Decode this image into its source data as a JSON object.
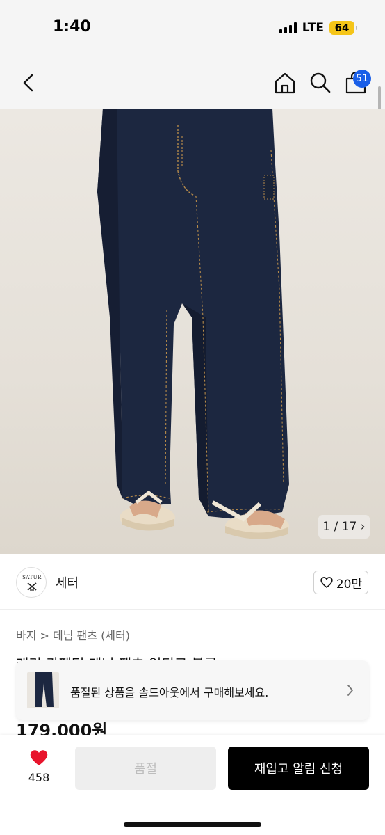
{
  "status_bar": {
    "time": "1:40",
    "network": "LTE",
    "battery": "64"
  },
  "nav": {
    "cart_count": "51"
  },
  "product_image": {
    "counter": "1 / 17 ›"
  },
  "brand": {
    "logo_text": "SATUR",
    "name": "세터",
    "likes": "20만"
  },
  "breadcrumb": "바지 > 데님 팬츠 (세터)",
  "product": {
    "title": "캐리 카펜터 데님 팬츠 인디고 블루",
    "price": "179,000원"
  },
  "soldout_banner": {
    "text": "품절된 상품을 솔드아웃에서 구매해보세요."
  },
  "bottom_bar": {
    "like_count": "458",
    "soldout_label": "품절",
    "restock_label": "재입고 알림 신청"
  },
  "colors": {
    "accent_badge": "#1a5fe8",
    "heart_red": "#e8142c",
    "battery_yellow": "#f5c518",
    "denim": "#1c2740"
  }
}
